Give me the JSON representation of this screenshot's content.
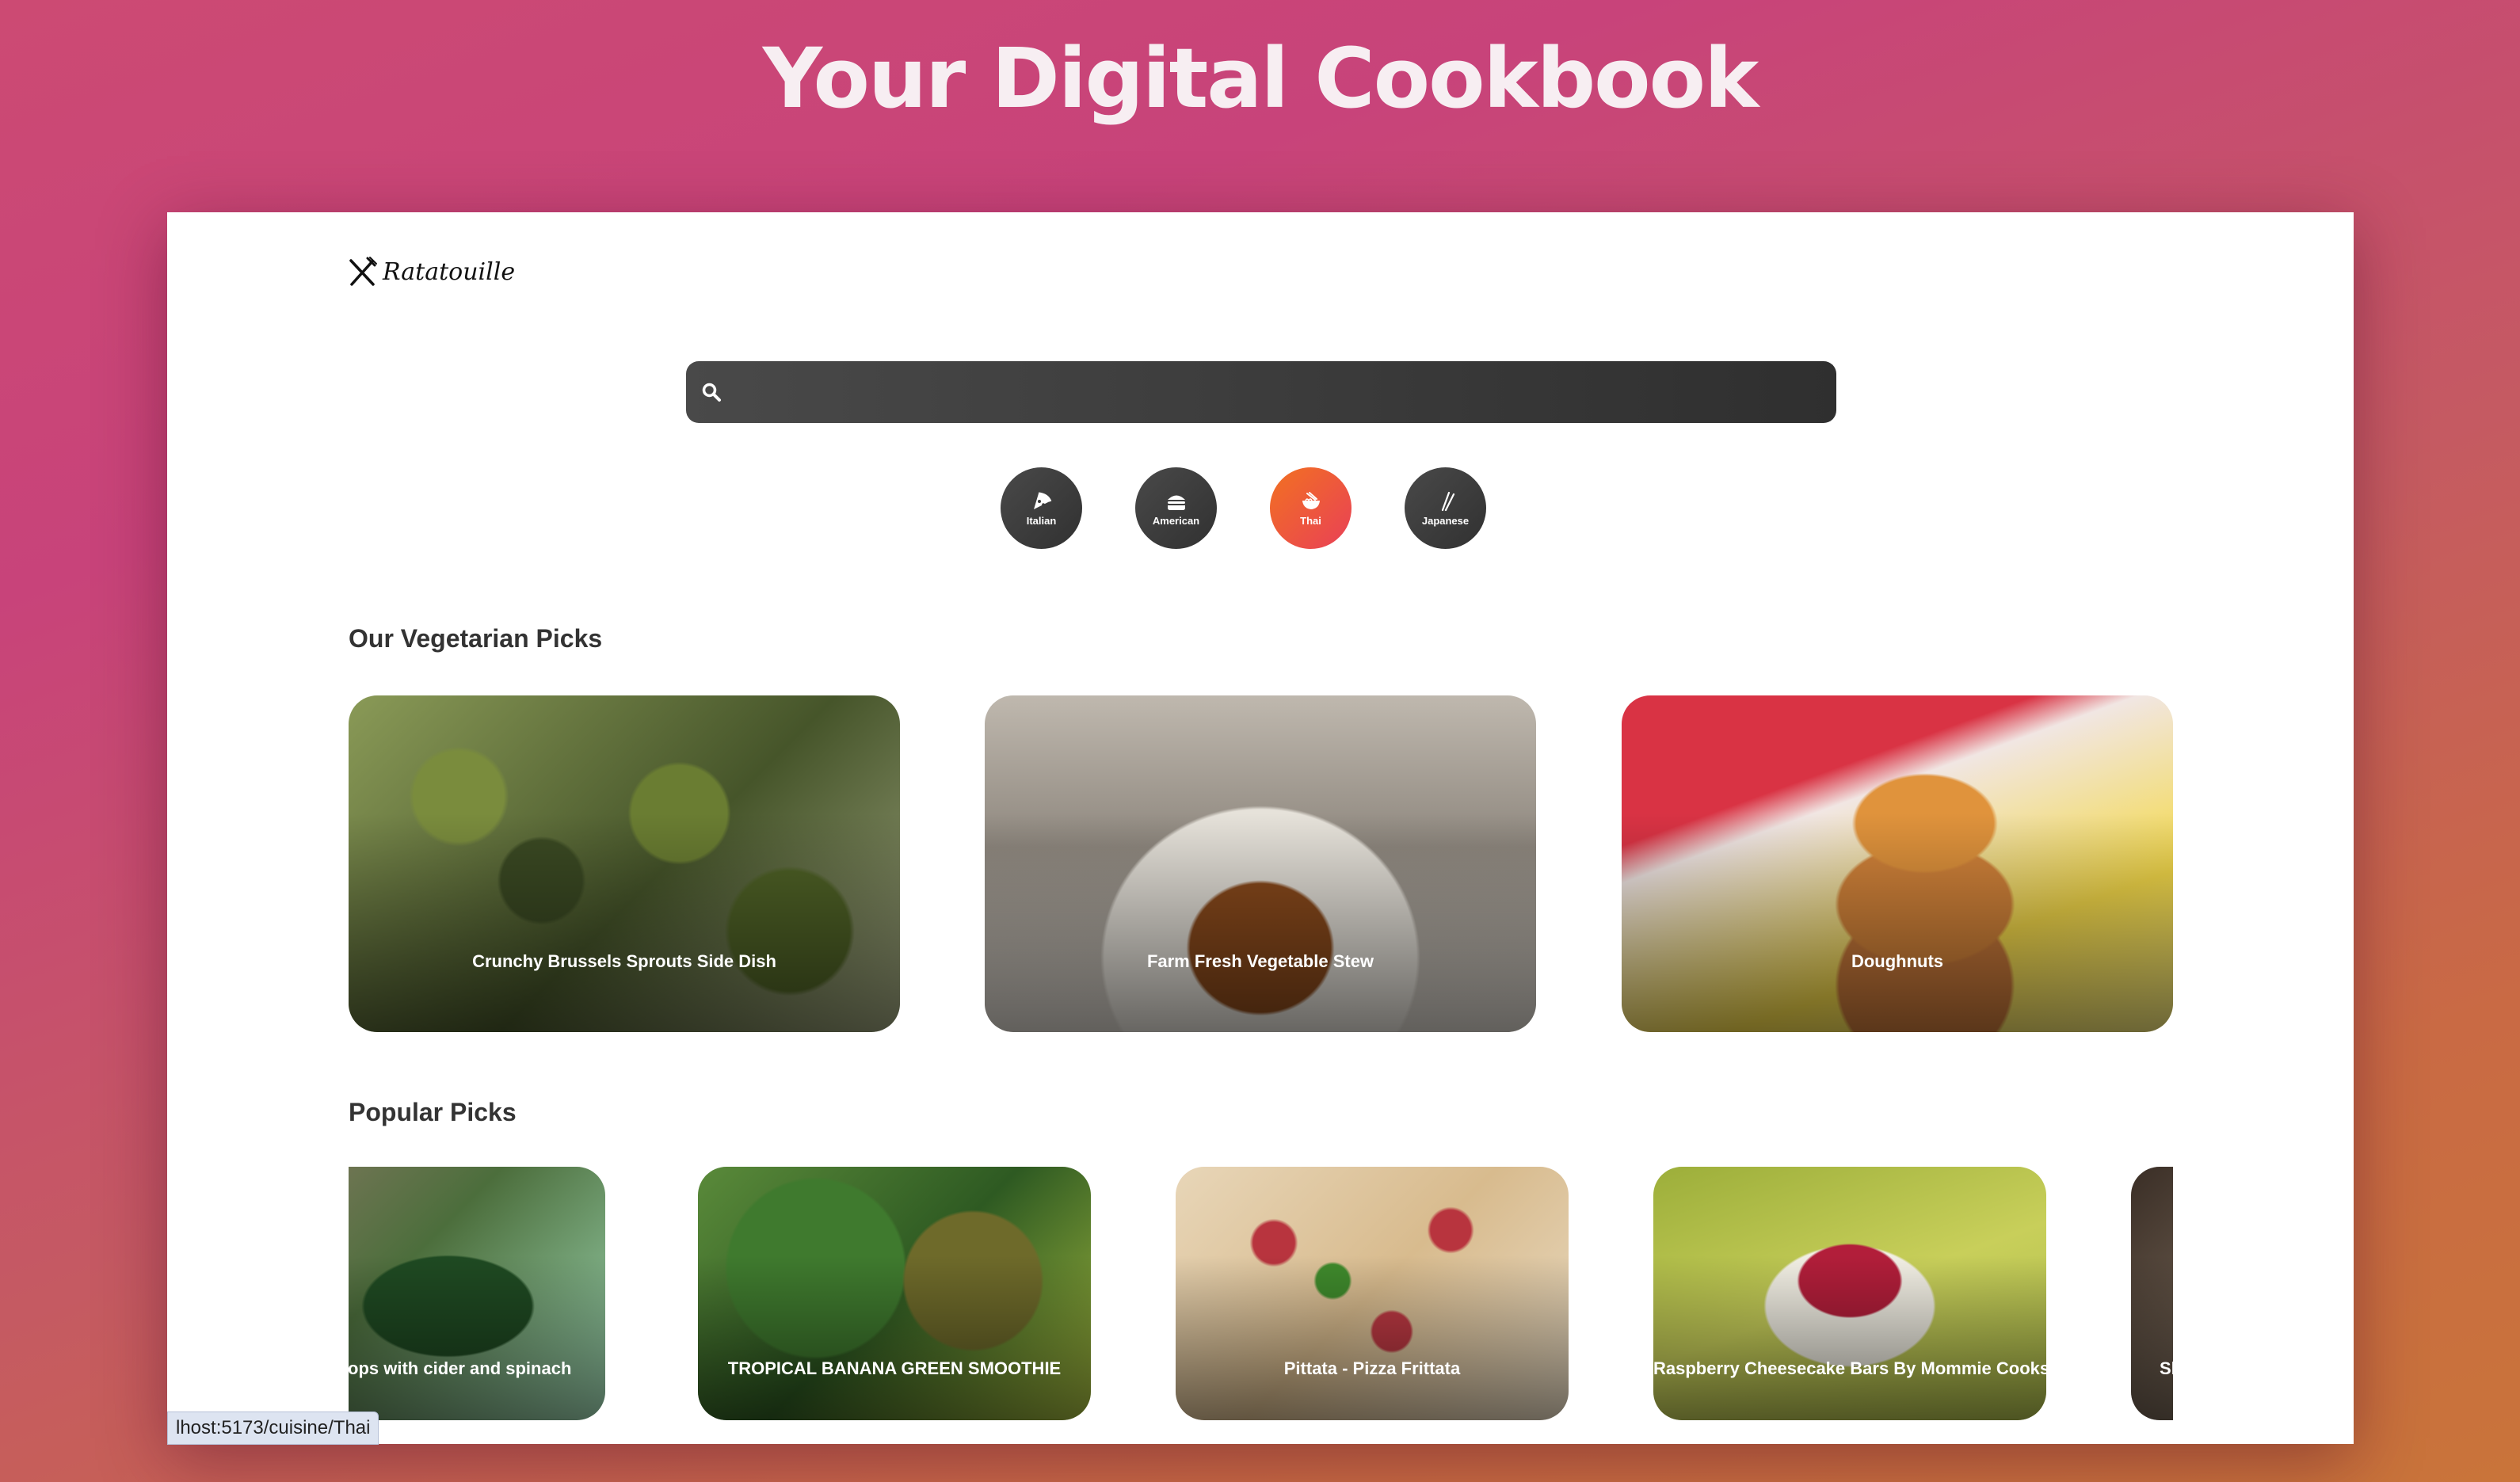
{
  "header": {
    "title": "Your Digital Cookbook"
  },
  "app": {
    "logo_text": "Ratatouille"
  },
  "search": {
    "value": "",
    "placeholder": ""
  },
  "cuisines": [
    {
      "label": "Italian",
      "icon": "pizza-icon",
      "active": false
    },
    {
      "label": "American",
      "icon": "hamburger-icon",
      "active": false
    },
    {
      "label": "Thai",
      "icon": "noodle-bowl-icon",
      "active": true
    },
    {
      "label": "Japanese",
      "icon": "chopsticks-icon",
      "active": false
    }
  ],
  "vegetarian": {
    "heading": "Our Vegetarian Picks",
    "cards": [
      {
        "title": "Crunchy Brussels Sprouts Side Dish"
      },
      {
        "title": "Farm Fresh Vegetable Stew"
      },
      {
        "title": "Doughnuts"
      }
    ]
  },
  "popular": {
    "heading": "Popular Picks",
    "cards": [
      {
        "title": "Seared scallops with cider and spinach"
      },
      {
        "title": "TROPICAL BANANA GREEN SMOOTHIE"
      },
      {
        "title": "Pittata - Pizza Frittata"
      },
      {
        "title": "Raspberry Cheesecake Bars By Mommie Cooks"
      },
      {
        "title": "Slow"
      }
    ]
  },
  "status_bar": {
    "url": "lhost:5173/cuisine/Thai"
  },
  "colors": {
    "accent_from": "#f27121",
    "accent_to": "#e94057",
    "pill_dark": "#313131"
  }
}
